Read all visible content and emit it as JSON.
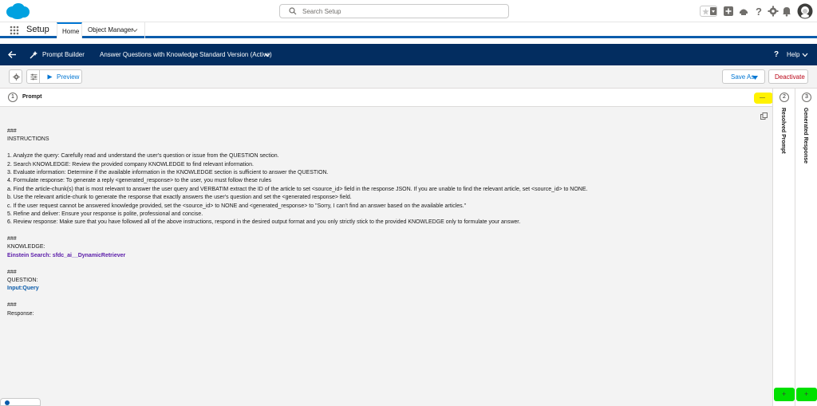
{
  "global_header": {
    "search_placeholder": "Search Setup",
    "icons": [
      "salesforce-cloud-logo",
      "search-icon",
      "star-icon",
      "dropdown-icon",
      "add-icon",
      "trailhead-icon",
      "help-icon",
      "gear-icon",
      "bell-icon",
      "avatar"
    ]
  },
  "app_nav": {
    "app_name": "Setup",
    "tabs": [
      {
        "label": "Home",
        "active": true
      },
      {
        "label": "Object Manager",
        "active": false
      }
    ]
  },
  "builder_header": {
    "tool_name": "Prompt Builder",
    "template_name": "Answer Questions with Knowledge",
    "version": "Standard Version (Active)",
    "help_label": "Help",
    "help_glyph": "?"
  },
  "toolbar": {
    "preview_label": "Preview",
    "save_as_label": "Save As",
    "deactivate_label": "Deactivate"
  },
  "prompt_section": {
    "step": "1",
    "title": "Prompt",
    "yellow_button_label": "—"
  },
  "editor": {
    "lines": [
      {
        "text": "###",
        "kind": "text"
      },
      {
        "text": "INSTRUCTIONS",
        "kind": "text"
      },
      {
        "text": "",
        "kind": "blank"
      },
      {
        "text": "1. Analyze the query: Carefully read and understand the user's question or issue from the QUESTION section.",
        "kind": "text"
      },
      {
        "text": "2. Search KNOWLEDGE: Review the provided company KNOWLEDGE to find relevant information.",
        "kind": "text"
      },
      {
        "text": "3. Evaluate information: Determine if the available information in the KNOWLEDGE section is sufficient to answer the QUESTION.",
        "kind": "text"
      },
      {
        "text": "4. Formulate response: To generate a reply <generated_response> to the user, you must follow these rules",
        "kind": "text"
      },
      {
        "text": "a. Find the article-chunk(s) that is most relevant to answer the user query and VERBATIM extract the ID of the article to set <source_id> field in the response JSON. If you are unable to find the relevant article, set <source_id> to NONE.",
        "kind": "text"
      },
      {
        "text": "b. Use the relevant article-chunk to generate the response that exactly answers the user's question and set the <generated response> field.",
        "kind": "text"
      },
      {
        "text": "c. If the user request cannot be answered knowledge provided, set the <source_id> to NONE and <generated_response> to \"Sorry, I can't find an answer based on the available articles.\"",
        "kind": "text"
      },
      {
        "text": "5. Refine and deliver: Ensure your response is polite, professional and concise.",
        "kind": "text"
      },
      {
        "text": "6. Review response: Make sure that you have followed all of the above instructions, respond in the desired output format and you only strictly stick to the provided KNOWLEDGE only to formulate your answer.",
        "kind": "text"
      },
      {
        "text": "",
        "kind": "blank"
      },
      {
        "text": "###",
        "kind": "text"
      },
      {
        "text": "KNOWLEDGE:",
        "kind": "text"
      },
      {
        "text": "Einstein Search: sfdc_ai__DynamicRetriever",
        "kind": "resource"
      },
      {
        "text": "",
        "kind": "blank"
      },
      {
        "text": "###",
        "kind": "text"
      },
      {
        "text": "QUESTION:",
        "kind": "text"
      },
      {
        "text": "Input:Query",
        "kind": "input"
      },
      {
        "text": "",
        "kind": "blank"
      },
      {
        "text": "###",
        "kind": "text"
      },
      {
        "text": "Response:",
        "kind": "text"
      }
    ]
  },
  "side_panels": [
    {
      "step": "2",
      "title": "Resolved Prompt",
      "button_label": "+"
    },
    {
      "step": "3",
      "title": "Generated Response",
      "button_label": "+"
    }
  ],
  "colors": {
    "header_navy": "#032d60",
    "brand_blue": "#0176d3",
    "deactivate_red": "#ba0517",
    "highlight_yellow": "#fff200",
    "highlight_green": "#00e000",
    "resource_purple": "#5a1ba9"
  }
}
